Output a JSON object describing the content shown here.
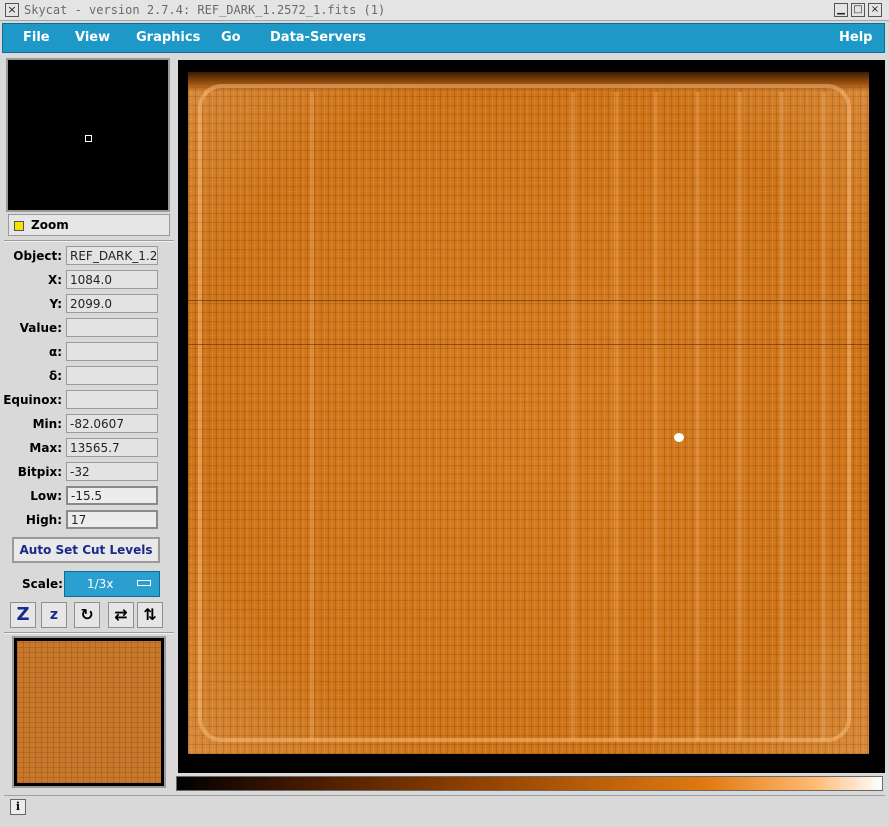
{
  "window": {
    "title": "Skycat - version 2.7.4: REF_DARK_1.2572_1.fits (1)",
    "close_glyph": "×",
    "minimize_glyph": "▁",
    "maximize_glyph": "□",
    "close2_glyph": "×"
  },
  "menubar": {
    "items": [
      "File",
      "View",
      "Graphics",
      "Go",
      "Data-Servers"
    ],
    "help": "Help"
  },
  "panel": {
    "zoom_label": "Zoom",
    "fields": [
      {
        "label": "Object:",
        "value": "REF_DARK_1.2"
      },
      {
        "label": "X:",
        "value": "1084.0"
      },
      {
        "label": "Y:",
        "value": "2099.0"
      },
      {
        "label": "Value:",
        "value": ""
      },
      {
        "label": "α:",
        "value": ""
      },
      {
        "label": "δ:",
        "value": ""
      },
      {
        "label": "Equinox:",
        "value": ""
      },
      {
        "label": "Min:",
        "value": "-82.0607"
      },
      {
        "label": "Max:",
        "value": "13565.7"
      },
      {
        "label": "Bitpix:",
        "value": "-32"
      },
      {
        "label": "Low:",
        "value": "-15.5"
      },
      {
        "label": "High:",
        "value": "17"
      }
    ],
    "auto_cut_label": "Auto Set Cut Levels",
    "scale_label": "Scale:",
    "scale_value": "1/3x",
    "tool_buttons": [
      {
        "icon": "zoom-in-icon",
        "glyph": "Z"
      },
      {
        "icon": "zoom-out-icon",
        "glyph": "z"
      },
      {
        "icon": "rotate-icon",
        "glyph": "↻"
      },
      {
        "icon": "flip-x-icon",
        "glyph": "⇄"
      },
      {
        "icon": "flip-y-icon",
        "glyph": "⇅"
      }
    ]
  },
  "colors": {
    "menubar": "#1d98c7",
    "image": "#d77c20",
    "highlight": "#f5e400"
  },
  "statusbar": {
    "info_glyph": "i",
    "message": ""
  }
}
